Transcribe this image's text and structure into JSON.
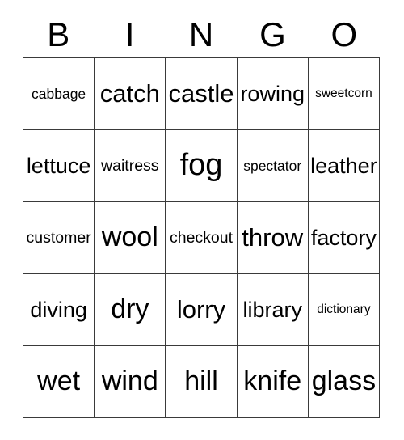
{
  "card": {
    "title": "BINGO",
    "header_letters": [
      "B",
      "I",
      "N",
      "G",
      "O"
    ],
    "columns": 5,
    "rows": 5,
    "colors": {
      "background": "#ffffff",
      "text": "#000000",
      "border": "#3a3a3a"
    },
    "grid": [
      [
        {
          "word": "cabbage",
          "size": "s"
        },
        {
          "word": "catch",
          "size": "xxl"
        },
        {
          "word": "castle",
          "size": "xxl"
        },
        {
          "word": "rowing",
          "size": "xl"
        },
        {
          "word": "sweetcorn",
          "size": "xs"
        }
      ],
      [
        {
          "word": "lettuce",
          "size": "xl"
        },
        {
          "word": "waitress",
          "size": "m"
        },
        {
          "word": "fog",
          "size": "hh"
        },
        {
          "word": "spectator",
          "size": "s"
        },
        {
          "word": "leather",
          "size": "xl"
        }
      ],
      [
        {
          "word": "customer",
          "size": "m"
        },
        {
          "word": "wool",
          "size": "h"
        },
        {
          "word": "checkout",
          "size": "m"
        },
        {
          "word": "throw",
          "size": "xxl"
        },
        {
          "word": "factory",
          "size": "xl"
        }
      ],
      [
        {
          "word": "diving",
          "size": "xl"
        },
        {
          "word": "dry",
          "size": "h"
        },
        {
          "word": "lorry",
          "size": "xxl"
        },
        {
          "word": "library",
          "size": "xl"
        },
        {
          "word": "dictionary",
          "size": "xs"
        }
      ],
      [
        {
          "word": "wet",
          "size": "h"
        },
        {
          "word": "wind",
          "size": "h"
        },
        {
          "word": "hill",
          "size": "h"
        },
        {
          "word": "knife",
          "size": "h"
        },
        {
          "word": "glass",
          "size": "h"
        }
      ]
    ]
  }
}
